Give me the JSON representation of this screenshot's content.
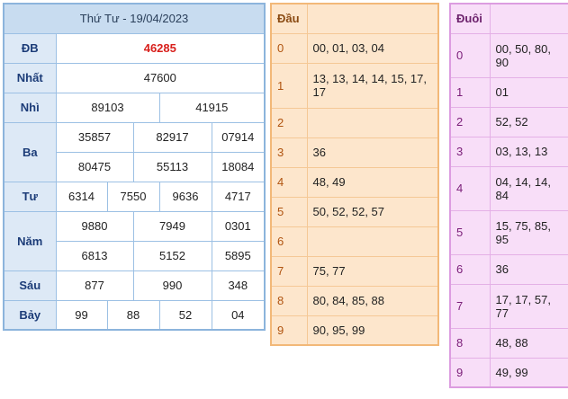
{
  "results": {
    "title": "Thứ Tư - 19/04/2023",
    "db": {
      "label": "ĐB",
      "values": [
        "46285"
      ]
    },
    "nhat": {
      "label": "Nhất",
      "values": [
        "47600"
      ]
    },
    "nhi": {
      "label": "Nhì",
      "values": [
        "89103",
        "41915"
      ]
    },
    "ba": {
      "label": "Ba",
      "values": [
        "35857",
        "82917",
        "07914",
        "80475",
        "55113",
        "18084"
      ]
    },
    "tu": {
      "label": "Tư",
      "values": [
        "6314",
        "7550",
        "9636",
        "4717"
      ]
    },
    "nam": {
      "label": "Năm",
      "values": [
        "9880",
        "7949",
        "0301",
        "6813",
        "5152",
        "5895"
      ]
    },
    "sau": {
      "label": "Sáu",
      "values": [
        "877",
        "990",
        "348"
      ]
    },
    "bay": {
      "label": "Bảy",
      "values": [
        "99",
        "88",
        "52",
        "04"
      ]
    }
  },
  "dau": {
    "header": "Đầu",
    "rows": [
      {
        "digit": "0",
        "values": "00, 01, 03, 04"
      },
      {
        "digit": "1",
        "values": "13, 13, 14, 14, 15, 17, 17"
      },
      {
        "digit": "2",
        "values": ""
      },
      {
        "digit": "3",
        "values": "36"
      },
      {
        "digit": "4",
        "values": "48, 49"
      },
      {
        "digit": "5",
        "values": "50, 52, 52, 57"
      },
      {
        "digit": "6",
        "values": ""
      },
      {
        "digit": "7",
        "values": "75, 77"
      },
      {
        "digit": "8",
        "values": "80, 84, 85, 88"
      },
      {
        "digit": "9",
        "values": "90, 95, 99"
      }
    ]
  },
  "duoi": {
    "header": "Đuôi",
    "rows": [
      {
        "digit": "0",
        "values": "00, 50, 80, 90"
      },
      {
        "digit": "1",
        "values": "01"
      },
      {
        "digit": "2",
        "values": "52, 52"
      },
      {
        "digit": "3",
        "values": "03, 13, 13"
      },
      {
        "digit": "4",
        "values": "04, 14, 14, 84"
      },
      {
        "digit": "5",
        "values": "15, 75, 85, 95"
      },
      {
        "digit": "6",
        "values": "36"
      },
      {
        "digit": "7",
        "values": "17, 17, 57, 77"
      },
      {
        "digit": "8",
        "values": "48, 88"
      },
      {
        "digit": "9",
        "values": "49, 99"
      }
    ]
  },
  "colors": {
    "results_border": "#8cb4dc",
    "results_header": "#c8dcf0",
    "special_prize": "#d8201c",
    "dau_bg": "#fde6cc",
    "dau_border": "#f2b878",
    "duoi_bg": "#f8def8",
    "duoi_border": "#dc9ce0"
  }
}
